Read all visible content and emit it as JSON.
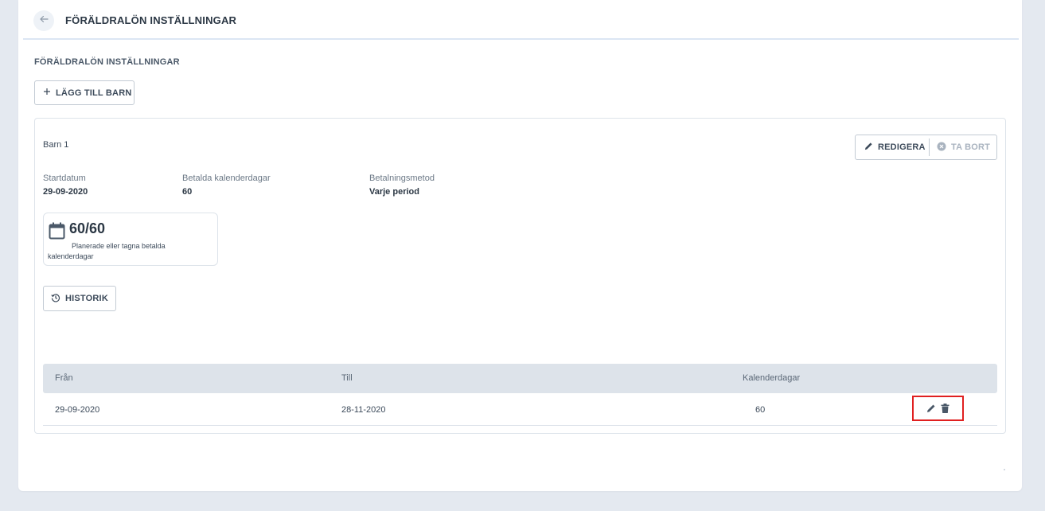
{
  "header": {
    "title": "FÖRÄLDRALÖN INSTÄLLNINGAR",
    "back_icon": "arrow-left-icon"
  },
  "section": {
    "title": "FÖRÄLDRALÖN INSTÄLLNINGAR",
    "add_child_label": "LÄGG TILL BARN"
  },
  "child": {
    "name": "Barn 1",
    "edit_label": "REDIGERA",
    "delete_label": "TA BORT",
    "fields": {
      "start_date_label": "Startdatum",
      "start_date_value": "29-09-2020",
      "paid_days_label": "Betalda kalenderdagar",
      "paid_days_value": "60",
      "payment_method_label": "Betalningsmetod",
      "payment_method_value": "Varje period"
    },
    "stat": {
      "value": "60/60",
      "description": "Planerade eller tagna betalda kalenderdagar"
    },
    "history_label": "HISTORIK",
    "table": {
      "headers": [
        "Från",
        "Till",
        "Kalenderdagar"
      ],
      "rows": [
        {
          "from": "29-09-2020",
          "to": "28-11-2020",
          "days": "60"
        }
      ]
    }
  },
  "colors": {
    "background": "#e4e9f0",
    "table_header": "#dde3ea",
    "highlight": "#e02020",
    "disabled_text": "#a9b3bf"
  }
}
